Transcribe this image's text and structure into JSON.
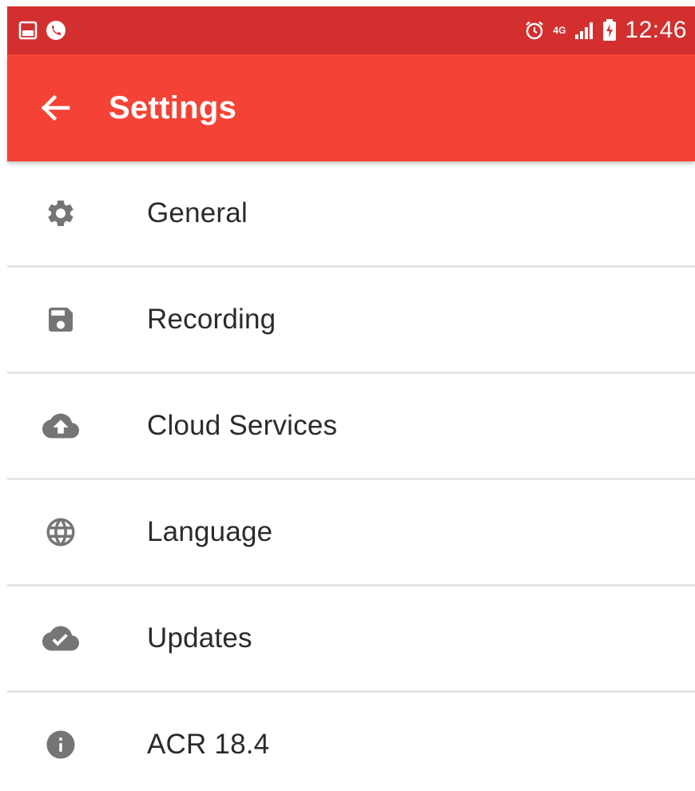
{
  "status_bar": {
    "time": "12:46",
    "network_type": "4G",
    "icons": [
      "gallery-icon",
      "phone-call-icon",
      "alarm-icon",
      "network-type-icon",
      "signal-icon",
      "battery-charging-icon"
    ]
  },
  "app_bar": {
    "title": "Settings",
    "back_icon": "arrow-back-icon"
  },
  "settings": {
    "items": [
      {
        "label": "General",
        "icon": "gear-icon"
      },
      {
        "label": "Recording",
        "icon": "save-icon"
      },
      {
        "label": "Cloud Services",
        "icon": "cloud-upload-icon"
      },
      {
        "label": "Language",
        "icon": "globe-icon"
      },
      {
        "label": "Updates",
        "icon": "cloud-done-icon"
      },
      {
        "label": "ACR 18.4",
        "icon": "info-icon"
      }
    ]
  },
  "colors": {
    "status_bar": "#d32f2f",
    "app_bar": "#f44336",
    "icon_gray": "#757575",
    "divider": "#e6e6e6"
  }
}
